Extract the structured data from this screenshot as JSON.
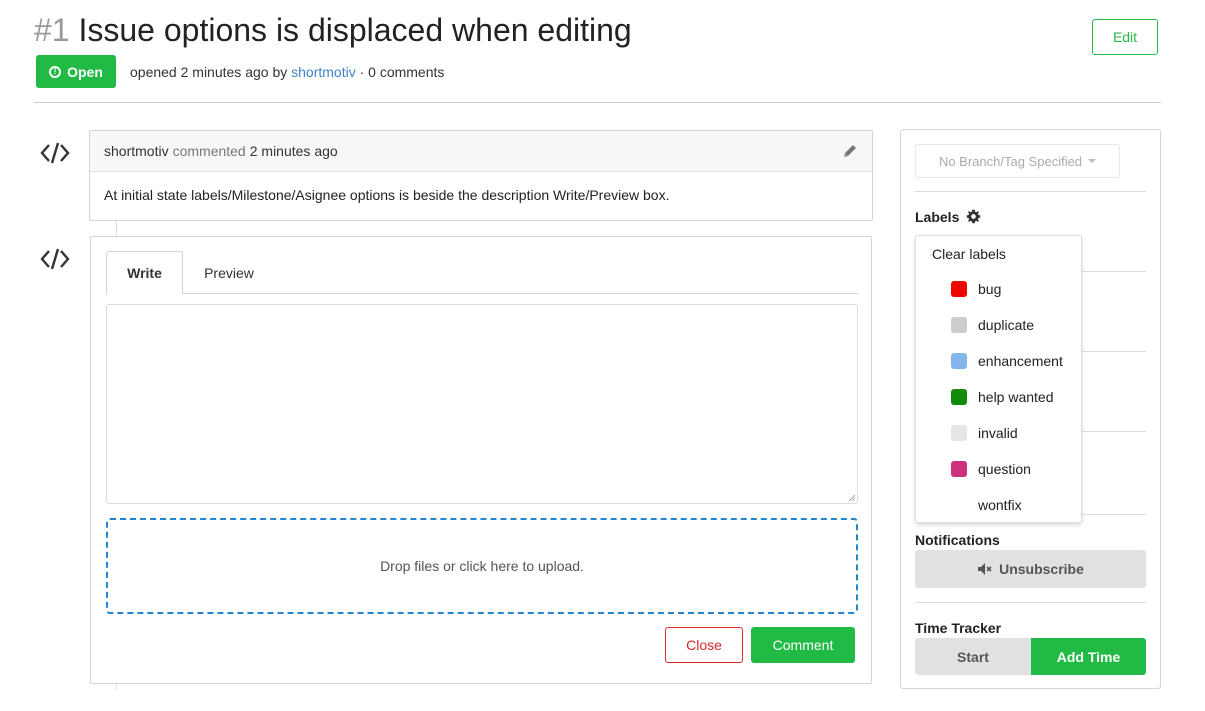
{
  "issue": {
    "number": "#1",
    "title": "Issue options is displaced when editing",
    "edit_label": "Edit",
    "status": "Open",
    "meta_prefix": "opened 2 minutes ago by",
    "author": "shortmotiv",
    "meta_suffix": "· 0 comments"
  },
  "comment": {
    "author": "shortmotiv",
    "action": "commented",
    "time": "2 minutes ago",
    "body": "At initial state labels/Milestone/Asignee options is beside the description Write/Preview box."
  },
  "editor": {
    "tab_write": "Write",
    "tab_preview": "Preview",
    "textarea_value": "",
    "dropzone_text": "Drop files or click here to upload.",
    "close_label": "Close",
    "comment_label": "Comment"
  },
  "sidebar": {
    "branch_placeholder": "No Branch/Tag Specified",
    "labels_heading": "Labels",
    "notifications_heading": "Notifications",
    "unsubscribe_label": "Unsubscribe",
    "time_tracker_heading": "Time Tracker",
    "start_label": "Start",
    "add_time_label": "Add Time"
  },
  "labels_dropdown": {
    "clear": "Clear labels",
    "items": [
      {
        "name": "bug",
        "color": "#ee0701"
      },
      {
        "name": "duplicate",
        "color": "#cccccc"
      },
      {
        "name": "enhancement",
        "color": "#84b6eb"
      },
      {
        "name": "help wanted",
        "color": "#128a0c"
      },
      {
        "name": "invalid",
        "color": "#e6e6e6"
      },
      {
        "name": "question",
        "color": "#cc317c"
      },
      {
        "name": "wontfix",
        "color": "#ffffff"
      }
    ]
  },
  "colors": {
    "green": "#21ba45",
    "red": "#db2828",
    "link": "#4183c4",
    "blue_dash": "#2185d0"
  }
}
